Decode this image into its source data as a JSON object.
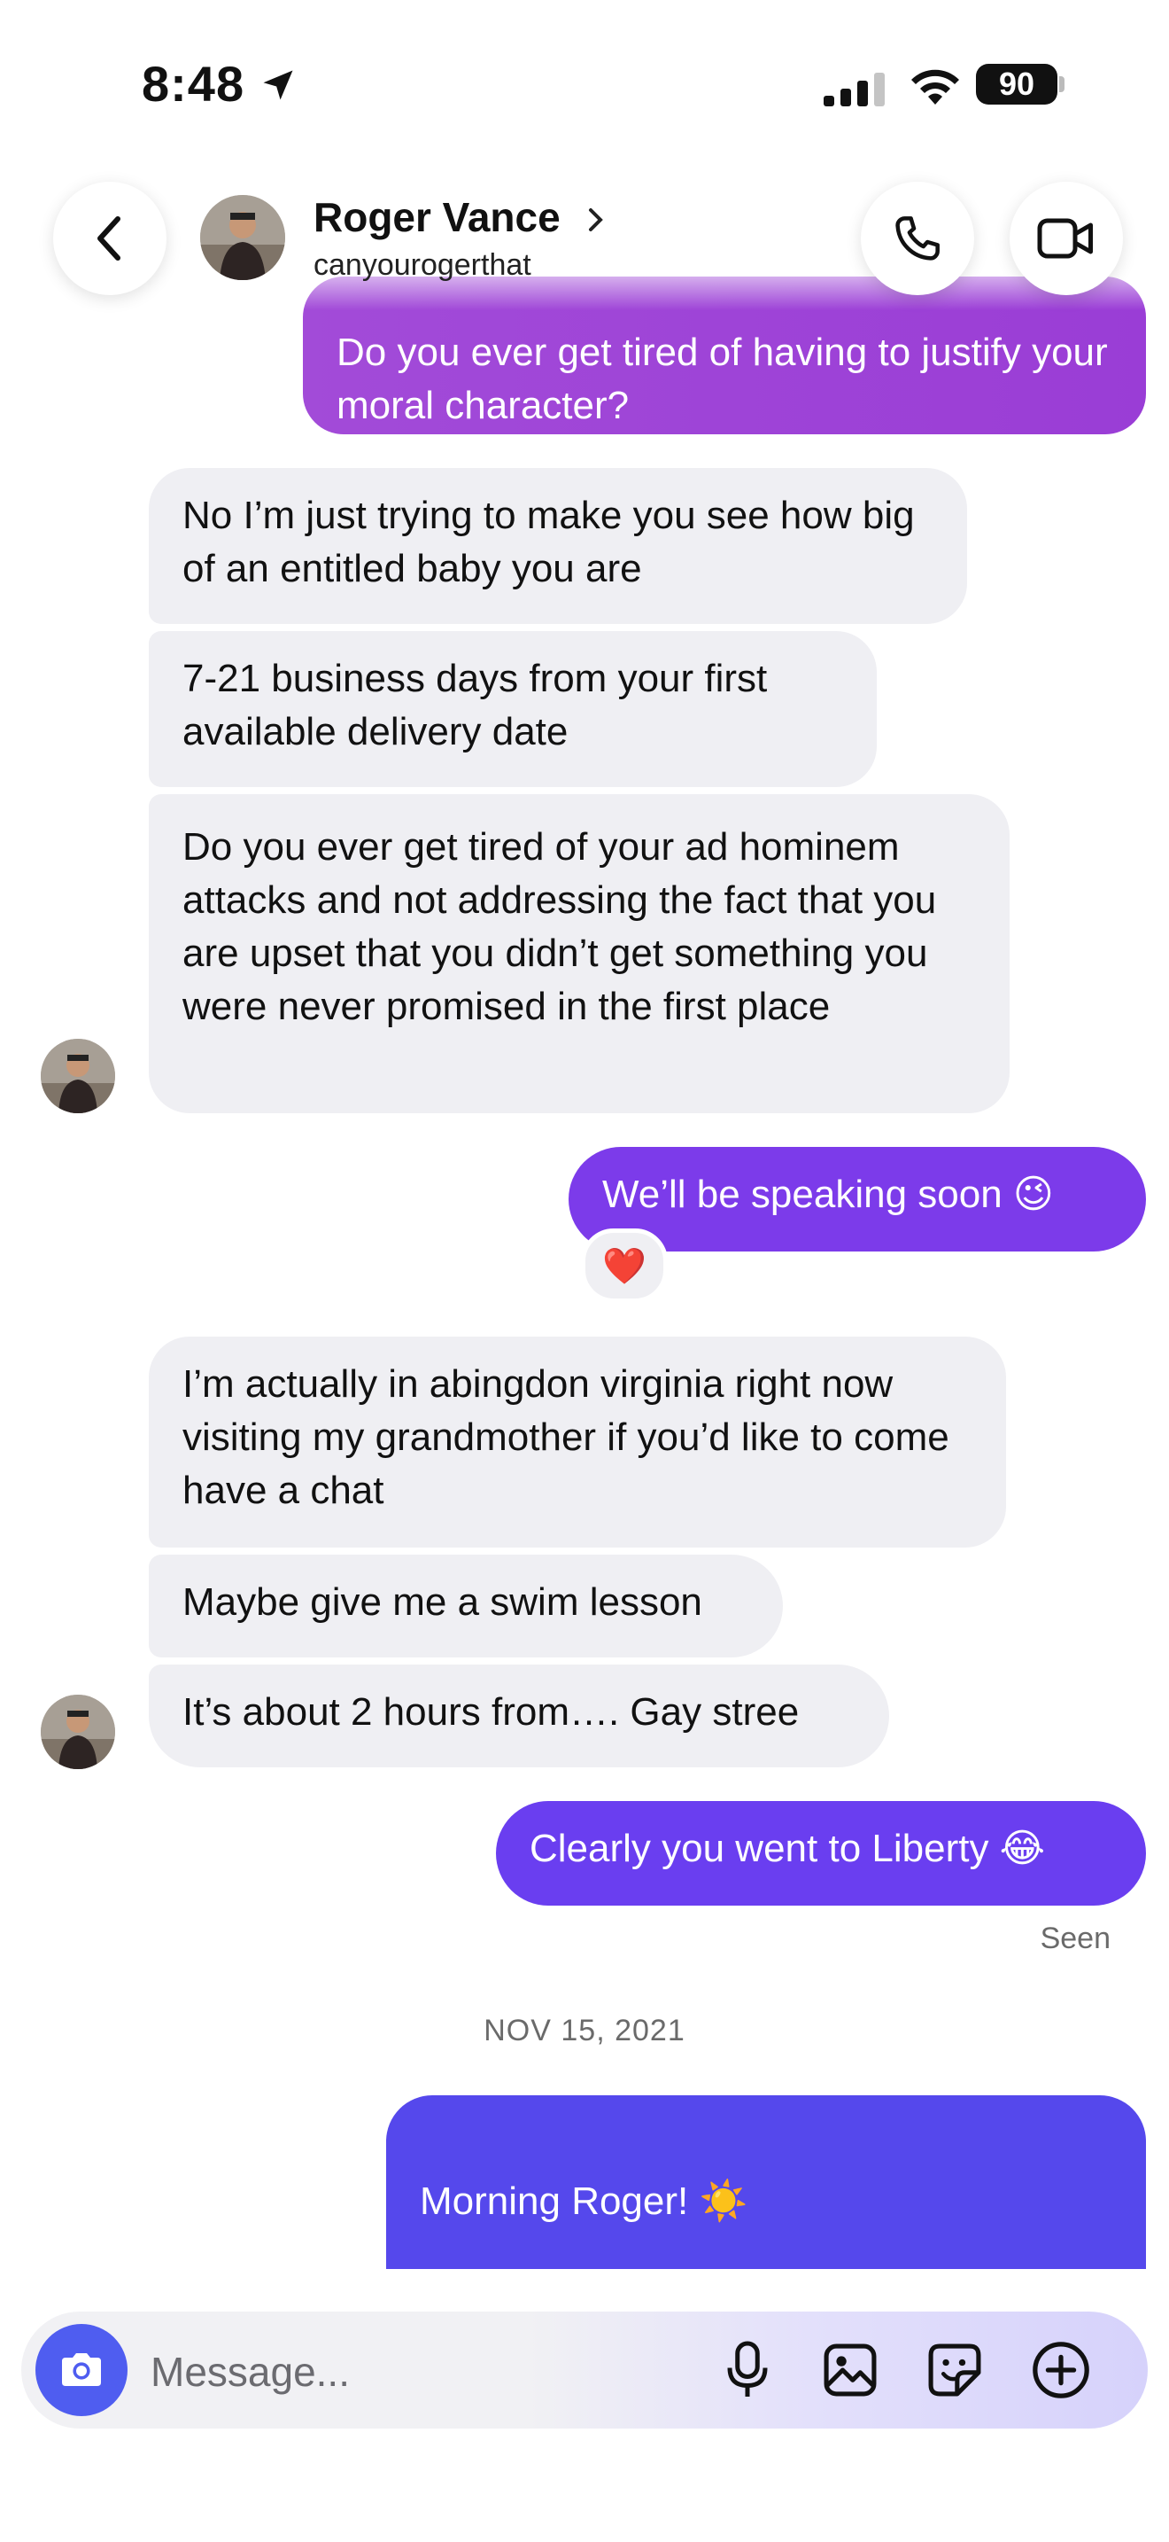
{
  "status_bar": {
    "time": "8:48",
    "battery": "90"
  },
  "header": {
    "name": "Roger Vance",
    "username": "canyourogerthat"
  },
  "messages": [
    {
      "dir": "sent",
      "text": "Do you ever get tired of having to justify your moral character?"
    },
    {
      "dir": "received",
      "text": "No I’m just trying to make you see how big of an entitled baby you are"
    },
    {
      "dir": "received",
      "text": "7-21 business days from your first available delivery date"
    },
    {
      "dir": "received",
      "text": "Do you ever get tired of your ad hominem attacks and not addressing the fact that you are upset that you didn’t get something you were never promised in the first place"
    },
    {
      "dir": "sent",
      "text": "We’ll be speaking soon 😉",
      "reaction": "❤️"
    },
    {
      "dir": "received",
      "text": "I’m actually in abingdon virginia right now visiting my grandmother if you’d like to come have a chat"
    },
    {
      "dir": "received",
      "text": "Maybe give me a swim lesson"
    },
    {
      "dir": "received",
      "text": "It’s about 2 hours from…. Gay stree"
    },
    {
      "dir": "sent",
      "text": "Clearly you went to Liberty 😂"
    },
    {
      "dir": "sent",
      "text": "Morning Roger! ☀️\n\nWhat’s on the docket for today?"
    }
  ],
  "seen_label": "Seen",
  "date_separator": "NOV 15, 2021",
  "composer": {
    "placeholder": "Message..."
  },
  "icons": [
    "back-icon",
    "phone-icon",
    "video-icon",
    "camera-icon",
    "microphone-icon",
    "image-icon",
    "sticker-icon",
    "plus-icon",
    "location-arrow-icon"
  ],
  "colors": {
    "sent_purple_1": "#9b3fdc",
    "sent_purple_2": "#7d3bea",
    "sent_purple_3": "#6a3ef0",
    "sent_purple_4": "#5548ec",
    "received_gray": "#efeff3",
    "camera_blue": "#4f5df0"
  }
}
